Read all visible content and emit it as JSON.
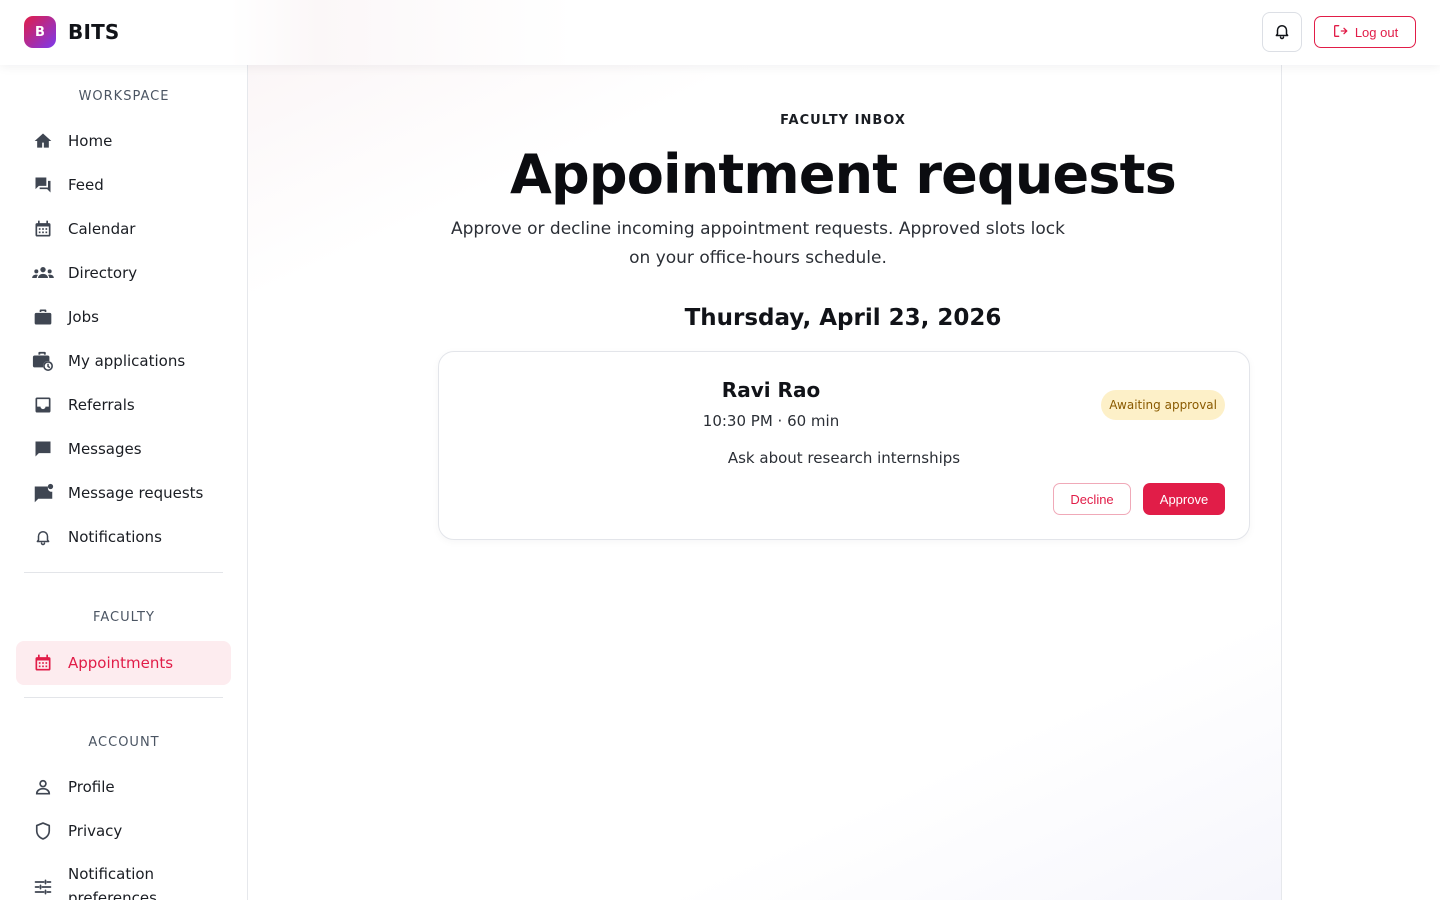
{
  "brand": {
    "logo_letter": "B",
    "name": "BITS"
  },
  "header": {
    "logout_label": "Log out",
    "bell_icon": "bell-icon",
    "logout_icon": "logout-icon"
  },
  "sidebar": {
    "workspace_title": "WORKSPACE",
    "workspace_items": [
      {
        "label": "Home",
        "icon": "home-icon"
      },
      {
        "label": "Feed",
        "icon": "forum-icon"
      },
      {
        "label": "Calendar",
        "icon": "calendar-icon"
      },
      {
        "label": "Directory",
        "icon": "people-icon"
      },
      {
        "label": "Jobs",
        "icon": "briefcase-icon"
      },
      {
        "label": "My applications",
        "icon": "briefcase-clock-icon"
      },
      {
        "label": "Referrals",
        "icon": "inbox-icon"
      },
      {
        "label": "Messages",
        "icon": "chat-icon"
      },
      {
        "label": "Message requests",
        "icon": "chat-badge-icon"
      },
      {
        "label": "Notifications",
        "icon": "bell-icon"
      }
    ],
    "faculty_title": "FACULTY",
    "faculty_items": [
      {
        "label": "Appointments",
        "icon": "calendar-icon",
        "active": true
      }
    ],
    "account_title": "ACCOUNT",
    "account_items": [
      {
        "label": "Profile",
        "icon": "person-icon"
      },
      {
        "label": "Privacy",
        "icon": "shield-icon"
      },
      {
        "label": "Notification preferences",
        "icon": "sliders-icon"
      }
    ]
  },
  "main": {
    "kicker": "FACULTY INBOX",
    "title": "Appointment requests",
    "subtitle": "Approve or decline incoming appointment requests. Approved slots lock on your office-hours schedule.",
    "date_heading": "Thursday, April 23, 2026",
    "request": {
      "name": "Ravi Rao",
      "time": "10:30 PM · 60 min",
      "reason": "Ask about research internships",
      "status": "Awaiting approval",
      "decline_label": "Decline",
      "approve_label": "Approve"
    }
  },
  "colors": {
    "accent": "#e11d48",
    "badge_bg": "#fdf0c8",
    "badge_text": "#8a5a00"
  }
}
